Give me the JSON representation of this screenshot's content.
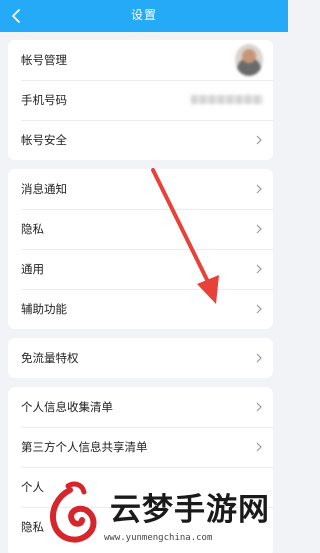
{
  "header": {
    "title": "设置",
    "back_icon": "back-arrow-icon"
  },
  "colors": {
    "header_bg": "#24aaf6",
    "page_bg": "#f2f3f7",
    "arrow": "#e8413a",
    "logo": "#d6262b"
  },
  "groups": [
    {
      "items": [
        {
          "label": "帐号管理",
          "right": "avatar"
        },
        {
          "label": "手机号码",
          "right": "masked-value"
        },
        {
          "label": "帐号安全",
          "right": "chevron"
        }
      ]
    },
    {
      "items": [
        {
          "label": "消息通知"
        },
        {
          "label": "隐私"
        },
        {
          "label": "通用"
        },
        {
          "label": "辅助功能"
        }
      ]
    },
    {
      "items": [
        {
          "label": "免流量特权"
        }
      ]
    },
    {
      "items": [
        {
          "label": "个人信息收集清单"
        },
        {
          "label": "第三方个人信息共享清单"
        },
        {
          "label": "个人"
        },
        {
          "label": "隐私"
        }
      ]
    }
  ],
  "watermark": {
    "text": "云梦手游网",
    "url": "www.yunmengchina.com"
  }
}
